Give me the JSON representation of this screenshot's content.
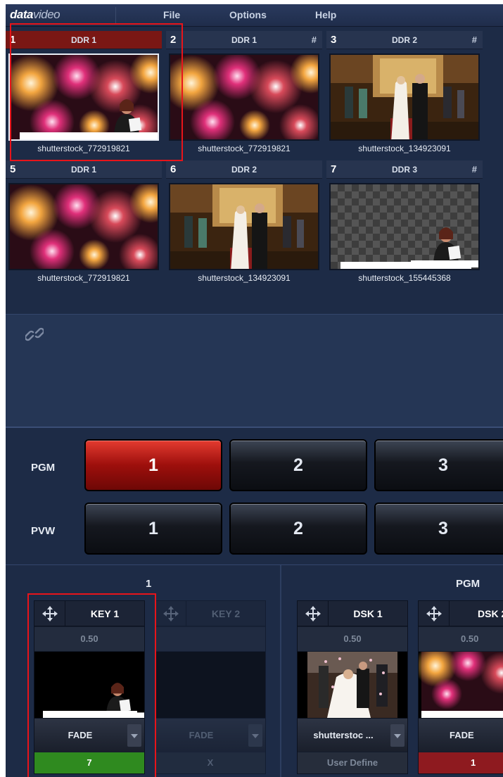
{
  "app": {
    "logo_bold": "data",
    "logo_light": "video"
  },
  "menu": {
    "file": "File",
    "options": "Options",
    "help": "Help"
  },
  "sources": [
    {
      "num": "1",
      "src": "DDR 1",
      "hash": "",
      "name": "shutterstock_772919821",
      "image": "fireworks-presenter",
      "active": true,
      "selected": true
    },
    {
      "num": "2",
      "src": "DDR 1",
      "hash": "#",
      "name": "shutterstock_772919821",
      "image": "fireworks"
    },
    {
      "num": "3",
      "src": "DDR 2",
      "hash": "#",
      "name": "shutterstock_134923091",
      "image": "wedding-church"
    },
    {
      "num": "5",
      "src": "DDR 1",
      "hash": "",
      "name": "shutterstock_772919821",
      "image": "fireworks"
    },
    {
      "num": "6",
      "src": "DDR 2",
      "hash": "",
      "name": "shutterstock_134923091",
      "image": "wedding-church"
    },
    {
      "num": "7",
      "src": "DDR 3",
      "hash": "#",
      "name": "shutterstock_155445368",
      "image": "presenter-transparent"
    }
  ],
  "link_icon": "chain-link-icon",
  "buses": {
    "pgm_label": "PGM",
    "pvw_label": "PVW",
    "pgm_buttons": [
      "1",
      "2",
      "3"
    ],
    "pvw_buttons": [
      "1",
      "2",
      "3"
    ],
    "pgm_active": "1"
  },
  "keyers": {
    "group_label": "1",
    "items": [
      {
        "name": "KEY 1",
        "value": "0.50",
        "select": "FADE",
        "footer": "7",
        "footer_style": "green",
        "image": "presenter"
      },
      {
        "name": "KEY 2",
        "value": "",
        "select": "FADE",
        "footer": "X",
        "footer_style": "grey",
        "image": "empty-add",
        "disabled": true
      }
    ]
  },
  "dsk": {
    "group_label": "PGM",
    "items": [
      {
        "name": "DSK 1",
        "value": "0.50",
        "select": "shutterstoc ...",
        "footer": "User Define",
        "footer_style": "grey",
        "image": "wedding-petals"
      },
      {
        "name": "DSK 2",
        "value": "0.50",
        "select": "FADE",
        "footer": "1",
        "footer_style": "red",
        "image": "fireworks-presenter"
      }
    ]
  },
  "colors": {
    "accent_red": "#e8141a",
    "active_key": "#2f8a1f",
    "active_dsk": "#8e1a1f",
    "panel": "#1d2b46"
  }
}
